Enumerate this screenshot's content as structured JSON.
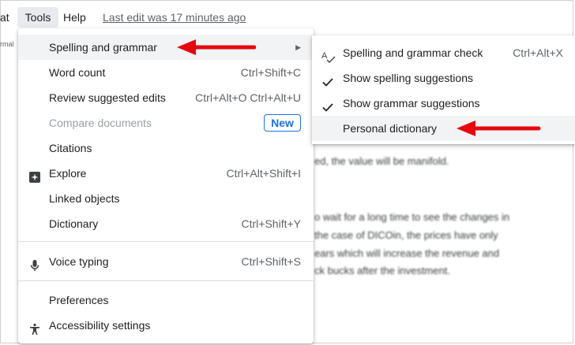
{
  "menubar": {
    "format_partial": "at",
    "tools": "Tools",
    "help": "Help",
    "last_edit": "Last edit was 17 minutes ago"
  },
  "toolbar_stub": "rmal",
  "document_lines": [
    "ed, the value will be manifold.",
    "o wait for a long time to see the changes in",
    "the case of DICOin, the prices have only",
    "ears which will increase the revenue and",
    "ck bucks after the investment."
  ],
  "tools_menu": {
    "items": [
      {
        "label": "Spelling and grammar",
        "submenu": true,
        "icon": "none"
      },
      {
        "label": "Word count",
        "shortcut": "Ctrl+Shift+C",
        "icon": "none"
      },
      {
        "label": "Review suggested edits",
        "shortcut": "Ctrl+Alt+O Ctrl+Alt+U",
        "icon": "none"
      },
      {
        "label": "Compare documents",
        "badge": "New",
        "disabled": true,
        "icon": "none"
      },
      {
        "label": "Citations",
        "icon": "none"
      },
      {
        "label": "Explore",
        "shortcut": "Ctrl+Alt+Shift+I",
        "icon": "explore-icon"
      },
      {
        "label": "Linked objects",
        "icon": "none"
      },
      {
        "label": "Dictionary",
        "shortcut": "Ctrl+Shift+Y",
        "icon": "none"
      },
      {
        "label": "Voice typing",
        "shortcut": "Ctrl+Shift+S",
        "icon": "microphone-icon"
      },
      {
        "label": "Preferences",
        "icon": "none"
      },
      {
        "label": "Accessibility settings",
        "icon": "accessibility-icon"
      }
    ]
  },
  "spelling_submenu": {
    "items": [
      {
        "label": "Spelling and grammar check",
        "shortcut": "Ctrl+Alt+X",
        "icon": "spellcheck-icon"
      },
      {
        "label": "Show spelling suggestions",
        "checked": true,
        "icon": "checkmark-icon"
      },
      {
        "label": "Show grammar suggestions",
        "checked": true,
        "icon": "checkmark-icon"
      },
      {
        "label": "Personal dictionary",
        "icon": "none"
      }
    ]
  },
  "colors": {
    "accent_blue": "#1a73e8",
    "annotation_red": "#e5090f",
    "highlight": "#f1f3f4"
  }
}
